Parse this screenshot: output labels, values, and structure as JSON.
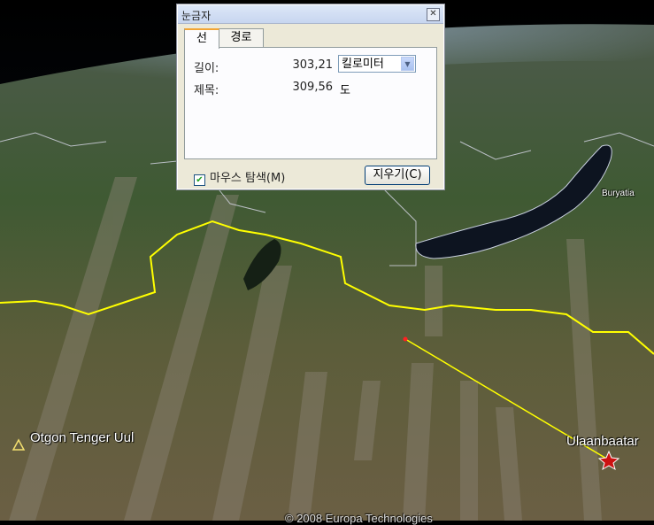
{
  "dialog": {
    "title": "눈금자",
    "close_glyph": "✕",
    "tabs": [
      {
        "label": "선"
      },
      {
        "label": "경로"
      }
    ],
    "length_label": "길이:",
    "length_value": "303,21",
    "unit_selected": "킬로미터",
    "heading_label": "제목:",
    "heading_value": "309,56",
    "heading_unit": "도",
    "mouse_nav_label": "마우스 탐색(M)",
    "mouse_nav_checked": true,
    "clear_button": "지우기(C)"
  },
  "map": {
    "place_otgon": "Otgon Tenger Uul",
    "place_ulaanbaatar": "Ulaanbaatar",
    "place_buryatia": "Buryatia",
    "copyright": "© 2008 Europa Technologies"
  },
  "colors": {
    "border_line": "#ffff00",
    "ruler_line": "#ffff00",
    "star_marker": "#cc1111"
  },
  "icons": {
    "peak": "triangle-outline-icon",
    "capital": "star-icon"
  }
}
